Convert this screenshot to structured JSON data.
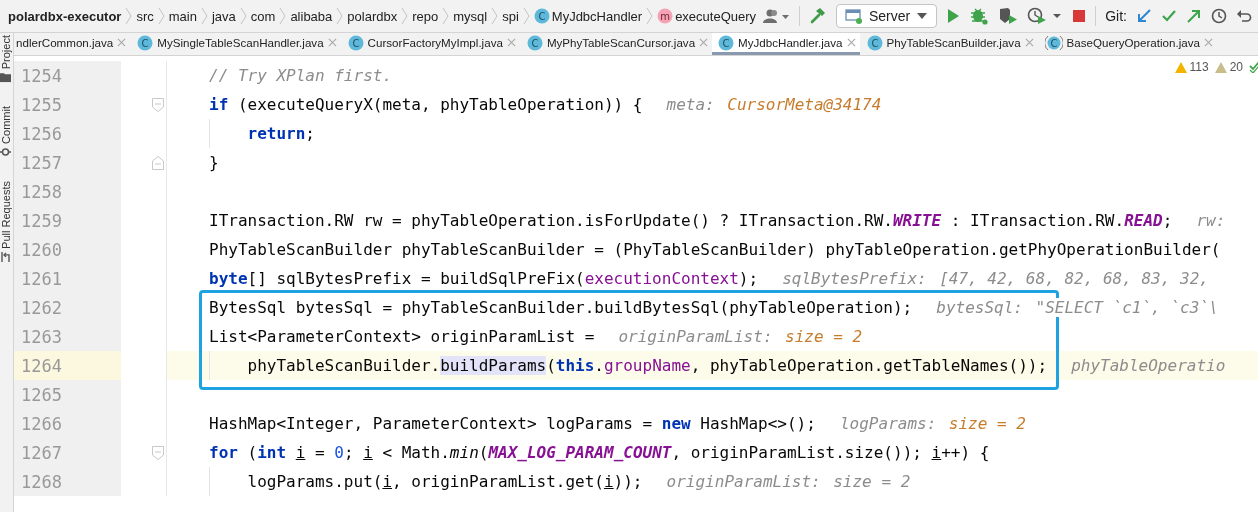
{
  "breadcrumbs": [
    {
      "label": "polardbx-executor",
      "kind": "project"
    },
    {
      "label": "src",
      "kind": "folder"
    },
    {
      "label": "main",
      "kind": "folder"
    },
    {
      "label": "java",
      "kind": "folder"
    },
    {
      "label": "com",
      "kind": "folder"
    },
    {
      "label": "alibaba",
      "kind": "folder"
    },
    {
      "label": "polardbx",
      "kind": "folder"
    },
    {
      "label": "repo",
      "kind": "folder"
    },
    {
      "label": "mysql",
      "kind": "folder"
    },
    {
      "label": "spi",
      "kind": "folder"
    },
    {
      "label": "MyJdbcHandler",
      "kind": "class",
      "icon_letter": "C"
    },
    {
      "label": "executeQuery",
      "kind": "method",
      "icon_letter": "m"
    }
  ],
  "run_config": {
    "label": "Server"
  },
  "vcs_label": "Git:",
  "tool_stripe": [
    {
      "label": "Project",
      "kind": "folder"
    },
    {
      "label": "Commit",
      "kind": "commit"
    },
    {
      "label": "Pull Requests",
      "kind": "pull-request"
    }
  ],
  "tabs": [
    {
      "label": "ndlerCommon.java",
      "kind": "file",
      "selected": false
    },
    {
      "label": "MySingleTableScanHandler.java",
      "kind": "class",
      "icon_letter": "C",
      "selected": false
    },
    {
      "label": "CursorFactoryMyImpl.java",
      "kind": "class",
      "icon_letter": "C",
      "selected": false
    },
    {
      "label": "MyPhyTableScanCursor.java",
      "kind": "class",
      "icon_letter": "C",
      "selected": false
    },
    {
      "label": "MyJdbcHandler.java",
      "kind": "class",
      "icon_letter": "C",
      "selected": true
    },
    {
      "label": "PhyTableScanBuilder.java",
      "kind": "class",
      "icon_letter": "C",
      "selected": false
    },
    {
      "label": "BaseQueryOperation.java",
      "kind": "abstract-class",
      "icon_letter": "C",
      "selected": false
    }
  ],
  "inspections": [
    {
      "kind": "warning",
      "count": "113"
    },
    {
      "kind": "weak-warning",
      "count": "20"
    }
  ],
  "lines": [
    {
      "number": "1254",
      "indented": false,
      "current": false,
      "boxed": false,
      "tokens": [
        {
          "kind": "comment",
          "text": "// Try XPlan first."
        }
      ]
    },
    {
      "number": "1255",
      "indented": false,
      "current": false,
      "boxed": false,
      "fold_marker": {
        "kind": "start"
      },
      "tokens": [
        {
          "kind": "keyword",
          "text": "if"
        },
        {
          "kind": "plain",
          "text": " (executeQueryX(meta, phyTableOperation)) {"
        }
      ],
      "hint": {
        "label": "meta:",
        "value": "CursorMeta@34174",
        "changed": true
      }
    },
    {
      "number": "1256",
      "indented": true,
      "current": false,
      "boxed": false,
      "tokens": [
        {
          "kind": "keyword",
          "text": "return"
        },
        {
          "kind": "plain",
          "text": ";"
        }
      ]
    },
    {
      "number": "1257",
      "indented": false,
      "current": false,
      "boxed": false,
      "fold_marker": {
        "kind": "end"
      },
      "tokens": [
        {
          "kind": "plain",
          "text": "}"
        }
      ]
    },
    {
      "number": "1258",
      "indented": false,
      "current": false,
      "boxed": false
    },
    {
      "number": "1259",
      "indented": false,
      "current": false,
      "boxed": false,
      "tokens": [
        {
          "kind": "plain",
          "text": "ITransaction.RW rw = phyTableOperation.isForUpdate() ? ITransaction.RW."
        },
        {
          "kind": "constant",
          "text": "WRITE"
        },
        {
          "kind": "plain",
          "text": " : ITransaction.RW."
        },
        {
          "kind": "constant",
          "text": "READ"
        },
        {
          "kind": "plain",
          "text": ";"
        }
      ],
      "hint": {
        "label": "rw:"
      }
    },
    {
      "number": "1260",
      "indented": false,
      "current": false,
      "boxed": false,
      "tokens": [
        {
          "kind": "plain",
          "text": "PhyTableScanBuilder phyTableScanBuilder = (PhyTableScanBuilder) phyTableOperation.getPhyOperationBuilder("
        }
      ]
    },
    {
      "number": "1261",
      "indented": false,
      "current": false,
      "boxed": false,
      "tokens": [
        {
          "kind": "keyword",
          "text": "byte"
        },
        {
          "kind": "plain",
          "text": "[] sqlBytesPrefix = buildSqlPreFix("
        },
        {
          "kind": "field",
          "text": "executionContext"
        },
        {
          "kind": "plain",
          "text": ");"
        }
      ],
      "hint": {
        "label": "sqlBytesPrefix:",
        "value": "[47, 42, 68, 82, 68, 83, 32,",
        "changed": false
      }
    },
    {
      "number": "1262",
      "indented": false,
      "current": false,
      "boxed": true,
      "tokens": [
        {
          "kind": "plain",
          "text": "BytesSql bytesSql = phyTableScanBuilder.buildBytesSql(phyTableOperation);"
        }
      ],
      "hint": {
        "label": "bytesSql:",
        "value": "\"SELECT `c1`, `c3`\\",
        "changed": false
      }
    },
    {
      "number": "1263",
      "indented": false,
      "current": false,
      "boxed": true,
      "tokens": [
        {
          "kind": "plain",
          "text": "List<ParameterContext> originParamList ="
        }
      ],
      "hint": {
        "label": "originParamList:",
        "value": "size = 2",
        "changed": true
      }
    },
    {
      "number": "1264",
      "indented": true,
      "current": true,
      "boxed": true,
      "tokens": [
        {
          "kind": "plain",
          "text": "phyTableScanBuilder."
        },
        {
          "kind": "usage",
          "text": "buildParams"
        },
        {
          "kind": "plain",
          "text": "("
        },
        {
          "kind": "keyword",
          "text": "this"
        },
        {
          "kind": "plain",
          "text": "."
        },
        {
          "kind": "field",
          "text": "groupName"
        },
        {
          "kind": "plain",
          "text": ", phyTableOperation.getTableNames());"
        }
      ],
      "hint": {
        "label": "phyTableOperatio"
      }
    },
    {
      "number": "1265",
      "indented": false,
      "current": false,
      "boxed": false
    },
    {
      "number": "1266",
      "indented": false,
      "current": false,
      "boxed": false,
      "tokens": [
        {
          "kind": "plain",
          "text": "HashMap<Integer, ParameterContext> logParams = "
        },
        {
          "kind": "keyword",
          "text": "new"
        },
        {
          "kind": "plain",
          "text": " HashMap<>();"
        }
      ],
      "hint": {
        "label": "logParams:",
        "value": "size = 2",
        "changed": true
      }
    },
    {
      "number": "1267",
      "indented": false,
      "current": false,
      "boxed": false,
      "fold_marker": {
        "kind": "start"
      },
      "tokens": [
        {
          "kind": "keyword",
          "text": "for"
        },
        {
          "kind": "plain",
          "text": " ("
        },
        {
          "kind": "keyword",
          "text": "int "
        },
        {
          "kind": "reassigned",
          "text": "i"
        },
        {
          "kind": "plain",
          "text": " = "
        },
        {
          "kind": "number",
          "text": "0"
        },
        {
          "kind": "plain",
          "text": "; "
        },
        {
          "kind": "reassigned",
          "text": "i"
        },
        {
          "kind": "plain",
          "text": " < Math."
        },
        {
          "kind": "static",
          "text": "min"
        },
        {
          "kind": "plain",
          "text": "("
        },
        {
          "kind": "constant",
          "text": "MAX_LOG_PARAM_COUNT"
        },
        {
          "kind": "plain",
          "text": ", originParamList.size()); "
        },
        {
          "kind": "reassigned",
          "text": "i"
        },
        {
          "kind": "plain",
          "text": "++) {"
        }
      ]
    },
    {
      "number": "1268",
      "indented": true,
      "current": false,
      "boxed": false,
      "tokens": [
        {
          "kind": "plain",
          "text": "logParams.put("
        },
        {
          "kind": "reassigned",
          "text": "i"
        },
        {
          "kind": "plain",
          "text": ", originParamList.get("
        },
        {
          "kind": "reassigned",
          "text": "i"
        },
        {
          "kind": "plain",
          "text": "));"
        }
      ],
      "hint": {
        "label": "originParamList:",
        "value": "size = 2",
        "changed": false
      }
    }
  ]
}
